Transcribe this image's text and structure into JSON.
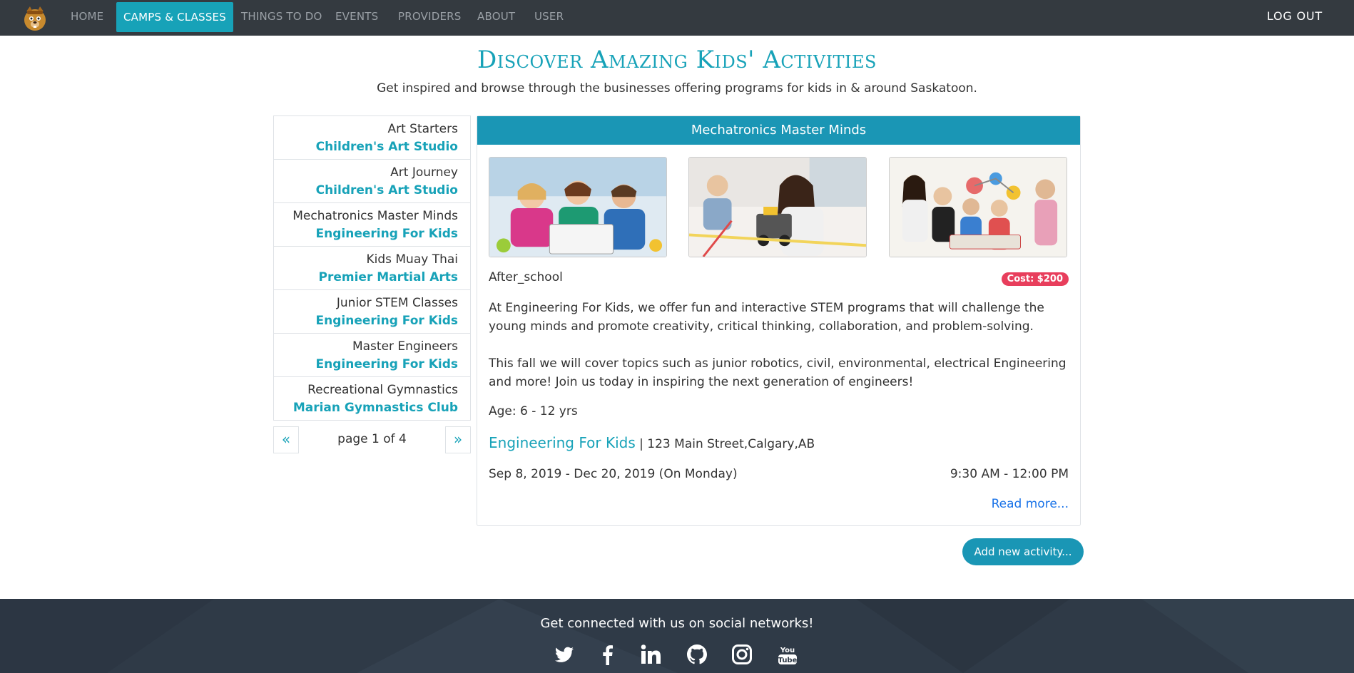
{
  "nav": {
    "items": [
      {
        "label": "Home"
      },
      {
        "label": "Camps & Classes"
      },
      {
        "label": "Things To Do"
      },
      {
        "label": "Events"
      },
      {
        "label": "Providers"
      },
      {
        "label": "About"
      },
      {
        "label": "User"
      }
    ],
    "logout": "Log Out"
  },
  "header": {
    "title": "Discover Amazing Kids' Activities",
    "subtitle": "Get inspired and browse through the businesses offering programs for kids in & around Saskatoon."
  },
  "list": {
    "items": [
      {
        "name": "Art Starters",
        "provider": "Children's Art Studio"
      },
      {
        "name": "Art Journey",
        "provider": "Children's Art Studio"
      },
      {
        "name": "Mechatronics Master Minds",
        "provider": "Engineering For Kids"
      },
      {
        "name": "Kids Muay Thai",
        "provider": "Premier Martial Arts"
      },
      {
        "name": "Junior STEM Classes",
        "provider": "Engineering For Kids"
      },
      {
        "name": "Master Engineers",
        "provider": "Engineering For Kids"
      },
      {
        "name": "Recreational Gymnastics",
        "provider": "Marian Gymnastics Club"
      }
    ],
    "pager": {
      "prev": "«",
      "next": "»",
      "text": "page 1 of 4"
    }
  },
  "detail": {
    "title": "Mechatronics Master Minds",
    "type": "After_school",
    "cost": "Cost: $200",
    "description": [
      "At Engineering For Kids, we offer fun and interactive STEM programs that will challenge the young minds and promote creativity, critical thinking, collaboration, and problem-solving.",
      "This fall we will cover topics such as junior robotics, civil, environmental, electrical Engineering and more! Join us today in inspiring the next generation of engineers!"
    ],
    "age": "Age: 6 - 12 yrs",
    "provider": "Engineering For Kids",
    "address": "| 123 Main Street,Calgary,AB",
    "dates": "Sep 8, 2019 - Dec 20, 2019 (On Monday)",
    "times": "9:30 AM - 12:00 PM",
    "read_more": "Read more..."
  },
  "add_button": "Add new activity...",
  "footer": {
    "title": "Get connected with us on social networks!",
    "icons": [
      "twitter-icon",
      "facebook-icon",
      "linkedin-icon",
      "github-icon",
      "instagram-icon",
      "youtube-icon"
    ]
  },
  "colors": {
    "navbar": "#343a40",
    "accent": "#17a2b8",
    "cost_badge": "#e83e5c",
    "link": "#1a73e8",
    "footer": "#2f3a47"
  }
}
